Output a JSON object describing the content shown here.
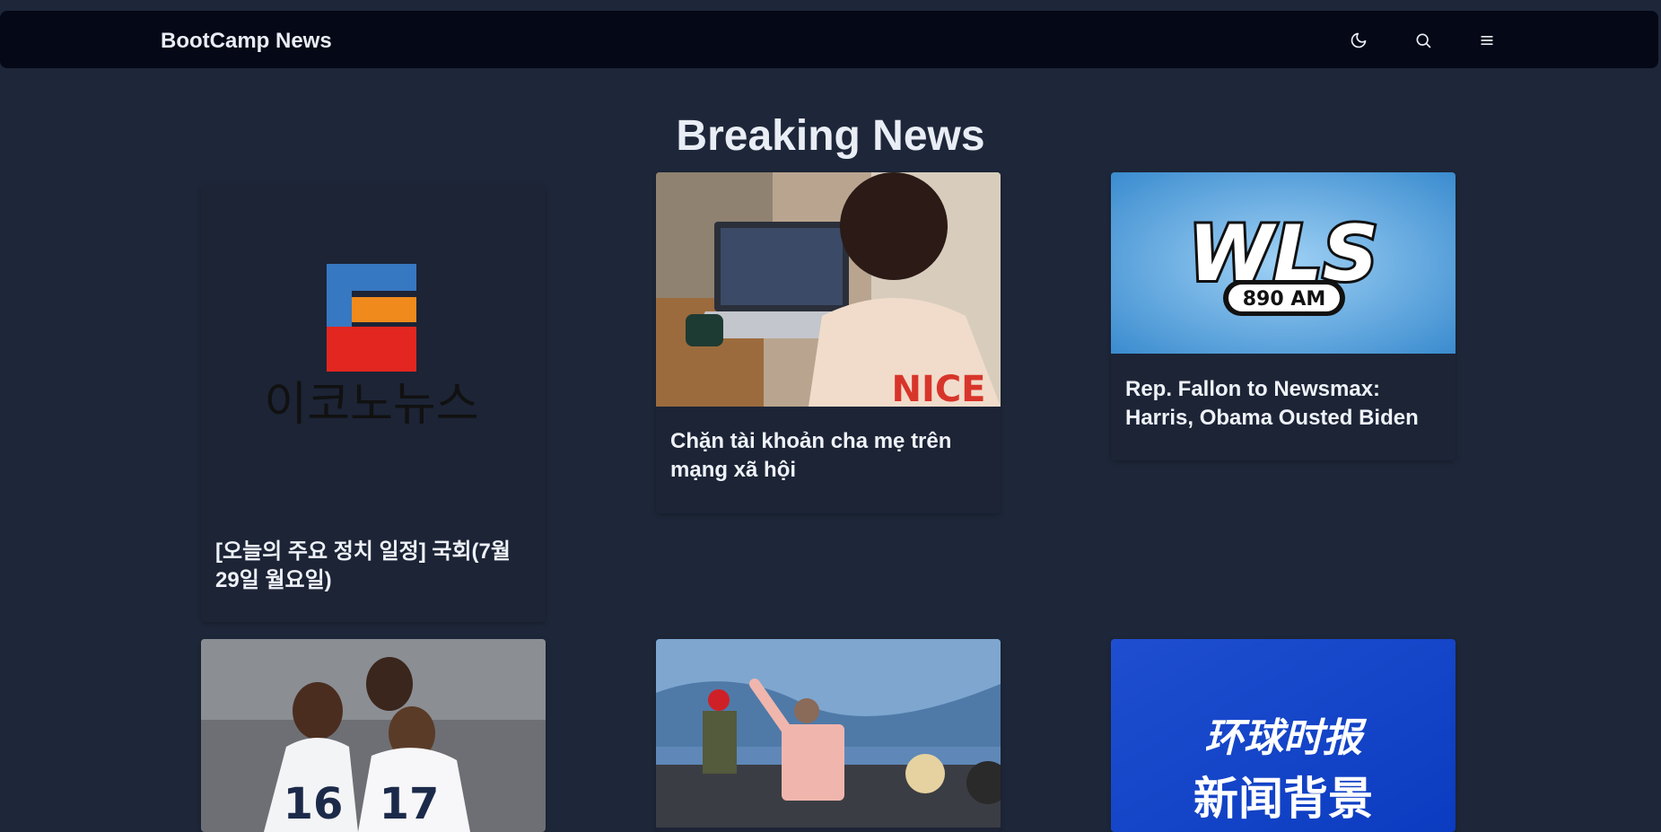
{
  "navbar": {
    "brand": "BootCamp News",
    "icons": [
      "moon-icon",
      "search-icon",
      "menu-icon"
    ]
  },
  "page": {
    "title": "Breaking News"
  },
  "articles": [
    {
      "title": "[오늘의 주요 정치 일정] 국회(7월 29일 월요일)",
      "logo_text": "이코노뉴스"
    },
    {
      "title": "Chặn tài khoản cha mẹ trên mạng xã hội",
      "image_text": "NICE"
    },
    {
      "title": "Rep. Fallon to Newsmax: Harris, Obama Ousted Biden",
      "logo_text": "WLS",
      "logo_sub": "890 AM"
    },
    {
      "title": "",
      "jersey_numbers": [
        "16",
        "17"
      ]
    },
    {
      "title": ""
    },
    {
      "title": "",
      "logo_text": "环球时报",
      "banner_text": "新闻背景"
    }
  ],
  "colors": {
    "background": "#1e2739",
    "navbar": "#050816",
    "card": "#1c2436",
    "text": "#e9edf5"
  }
}
